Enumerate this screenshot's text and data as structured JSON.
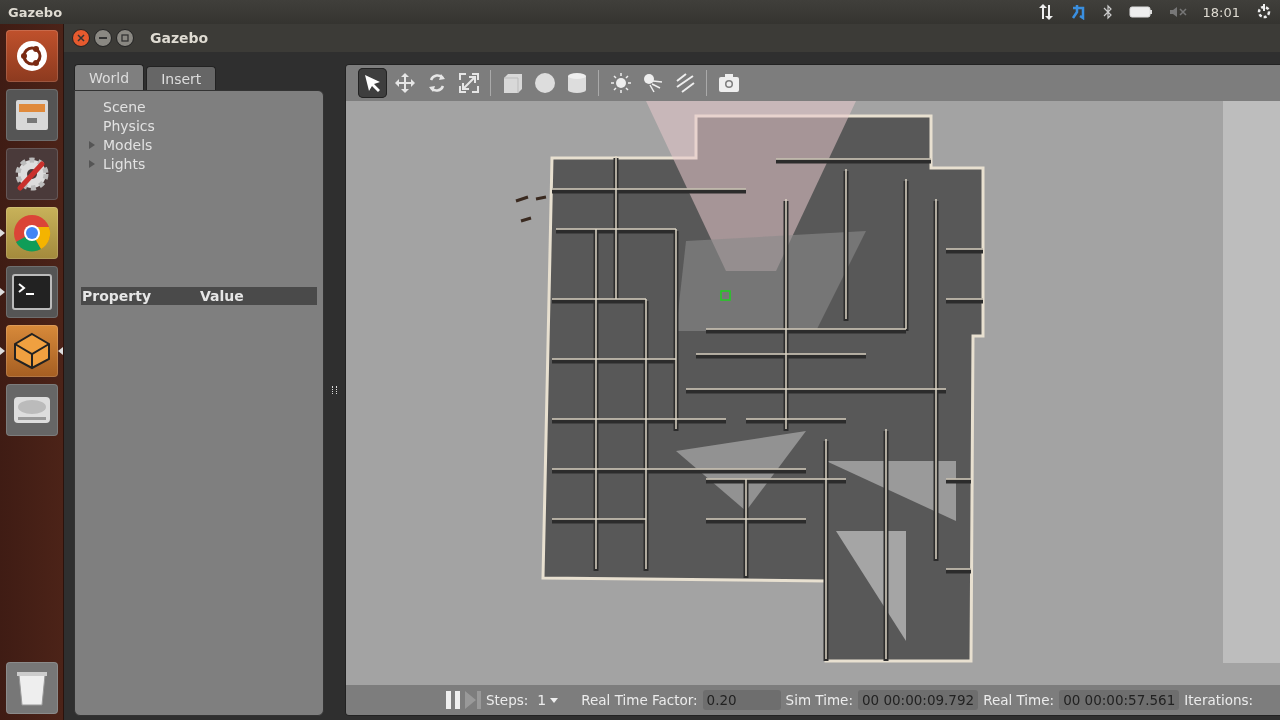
{
  "top_panel": {
    "app_name": "Gazebo",
    "time": "18:01",
    "sound_muted": true
  },
  "launcher": [
    {
      "kind": "dash",
      "running": false,
      "focused": false
    },
    {
      "kind": "files",
      "running": false,
      "focused": false
    },
    {
      "kind": "settings",
      "running": false,
      "focused": false
    },
    {
      "kind": "browser",
      "running": true,
      "focused": false
    },
    {
      "kind": "terminal",
      "running": true,
      "focused": false
    },
    {
      "kind": "gazebo",
      "running": true,
      "focused": true
    },
    {
      "kind": "disk",
      "running": false,
      "focused": false
    },
    {
      "kind": "trash",
      "running": false,
      "focused": false
    }
  ],
  "window": {
    "title": "Gazebo"
  },
  "tabs": [
    {
      "label": "World",
      "selected": true
    },
    {
      "label": "Insert",
      "selected": false
    }
  ],
  "tree": [
    {
      "label": "Scene",
      "expandable": false
    },
    {
      "label": "Physics",
      "expandable": false
    },
    {
      "label": "Models",
      "expandable": true
    },
    {
      "label": "Lights",
      "expandable": true
    }
  ],
  "property_table": {
    "columns": [
      "Property",
      "Value"
    ]
  },
  "toolbar": [
    {
      "kind": "select",
      "selected": true
    },
    {
      "kind": "translate",
      "selected": false
    },
    {
      "kind": "rotate",
      "selected": false
    },
    {
      "kind": "scale",
      "selected": false
    },
    {
      "kind": "separator"
    },
    {
      "kind": "box",
      "selected": false
    },
    {
      "kind": "sphere",
      "selected": false
    },
    {
      "kind": "cylinder",
      "selected": false
    },
    {
      "kind": "separator"
    },
    {
      "kind": "point_light",
      "selected": false
    },
    {
      "kind": "spot_light",
      "selected": false
    },
    {
      "kind": "directional_light",
      "selected": false
    },
    {
      "kind": "separator"
    },
    {
      "kind": "screenshot",
      "selected": false
    }
  ],
  "bottom_bar": {
    "paused": false,
    "steps_label": "Steps:",
    "steps_value": "1",
    "fields": [
      {
        "label": "Real Time Factor:",
        "value": "0.20"
      },
      {
        "label": "Sim Time:",
        "value": "00 00:00:09.792"
      },
      {
        "label": "Real Time:",
        "value": "00 00:00:57.561"
      }
    ],
    "iterations_label": "Iterations:"
  }
}
